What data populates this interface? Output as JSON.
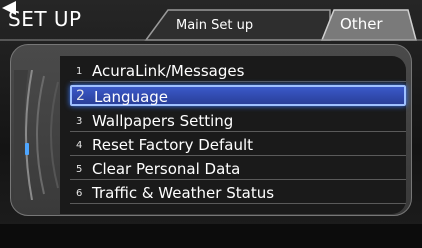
{
  "header": {
    "title": "SET UP",
    "tabs": [
      {
        "label": "Main Set up",
        "active": false
      },
      {
        "label": "Other",
        "active": true
      }
    ]
  },
  "menu": {
    "selected_index": 1,
    "items": [
      {
        "num": "1",
        "label": "AcuraLink/Messages"
      },
      {
        "num": "2",
        "label": "Language"
      },
      {
        "num": "3",
        "label": "Wallpapers Setting"
      },
      {
        "num": "4",
        "label": "Reset Factory Default"
      },
      {
        "num": "5",
        "label": "Clear Personal Data"
      },
      {
        "num": "6",
        "label": "Traffic & Weather Status"
      }
    ]
  },
  "colors": {
    "accent": "#3b59c9",
    "indicator": "#4ea6ff"
  }
}
